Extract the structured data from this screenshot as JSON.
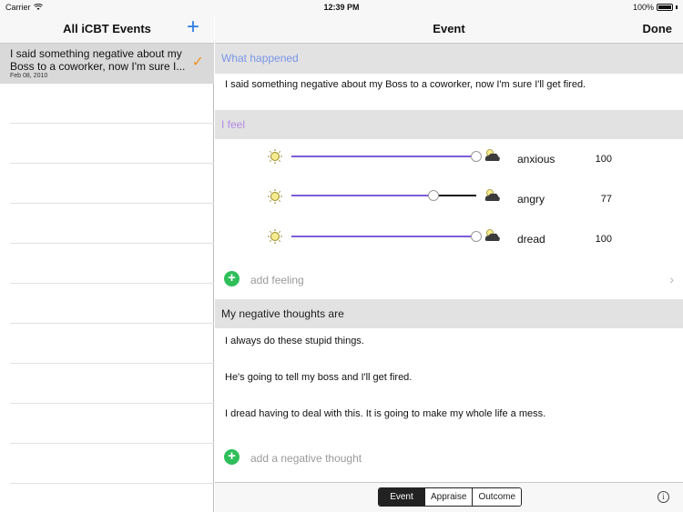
{
  "status_bar": {
    "carrier": "Carrier",
    "time": "12:39 PM",
    "battery": "100%"
  },
  "left_panel": {
    "title": "All iCBT Events",
    "add_icon": "plus-icon",
    "events": [
      {
        "title": "I said something negative about my Boss to a coworker, now I'm sure I...",
        "date": "Feb 08, 2010",
        "status_icon": "checkmark-icon"
      }
    ]
  },
  "right_panel": {
    "title": "Event",
    "done_label": "Done",
    "what_happened": {
      "header": "What happened",
      "text": "I said something negative about my Boss to a coworker, now I'm sure I'll get fired."
    },
    "feel": {
      "header": "I feel",
      "feelings": [
        {
          "label": "anxious",
          "value": "100",
          "level": 1.0
        },
        {
          "label": "angry",
          "value": "77",
          "level": 0.77
        },
        {
          "label": "dread",
          "value": "100",
          "level": 1.0
        }
      ],
      "add_label": "add feeling"
    },
    "negative_thoughts": {
      "header": "My negative thoughts are",
      "thoughts": [
        "I always do these stupid things.",
        "He's going to tell my boss and I'll get fired.",
        "I dread having to deal with this.  It is going to make my whole life a mess."
      ],
      "add_label": "add a negative thought"
    }
  },
  "toolbar": {
    "segments": [
      "Event",
      "Appraise",
      "Outcome"
    ],
    "selected": "Event",
    "info_icon": "info-icon"
  },
  "colors": {
    "accent": "#2a7ae4",
    "slider": "#7c5cdc",
    "add_green": "#2fbf5a",
    "check": "#f0902b"
  }
}
